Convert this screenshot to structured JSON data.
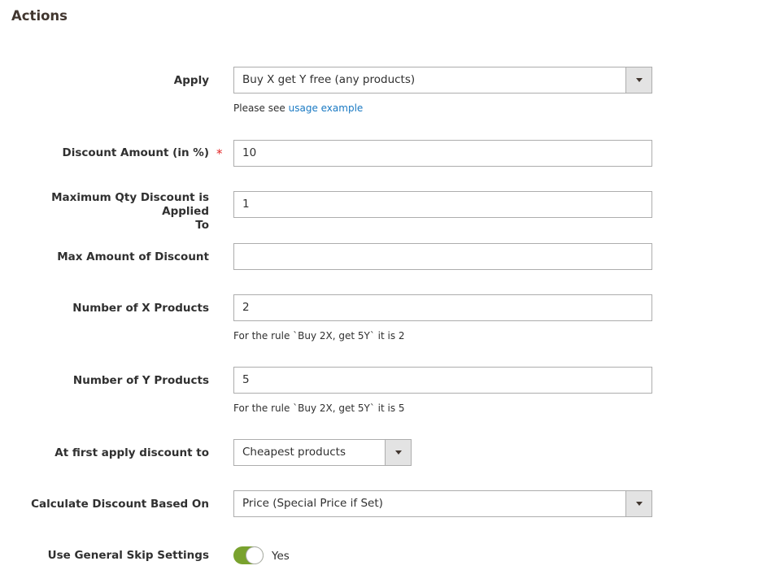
{
  "section": {
    "title": "Actions"
  },
  "fields": {
    "apply": {
      "label": "Apply",
      "value": "Buy X get Y free (any products)",
      "note_prefix": "Please see",
      "note_link": "usage example"
    },
    "discount_amount": {
      "label": "Discount Amount (in %)",
      "required_mark": "*",
      "value": "10"
    },
    "max_qty": {
      "label_line1": "Maximum Qty Discount is Applied",
      "label_line2": "To",
      "value": "1"
    },
    "max_amount": {
      "label": "Max Amount of Discount",
      "value": ""
    },
    "x_products": {
      "label": "Number of X Products",
      "value": "2",
      "note": "For the rule `Buy 2X, get 5Y` it is 2"
    },
    "y_products": {
      "label": "Number of Y Products",
      "value": "5",
      "note": "For the rule `Buy 2X, get 5Y` it is 5"
    },
    "first_apply": {
      "label": "At first apply discount to",
      "value": "Cheapest products"
    },
    "calc_based": {
      "label": "Calculate Discount Based On",
      "value": "Price (Special Price if Set)"
    },
    "skip_settings": {
      "label": "Use General Skip Settings",
      "toggle_label": "Yes",
      "enabled": true
    }
  },
  "colors": {
    "accent_link": "#1979c3",
    "toggle_on": "#79a22e",
    "required": "#e22626"
  }
}
